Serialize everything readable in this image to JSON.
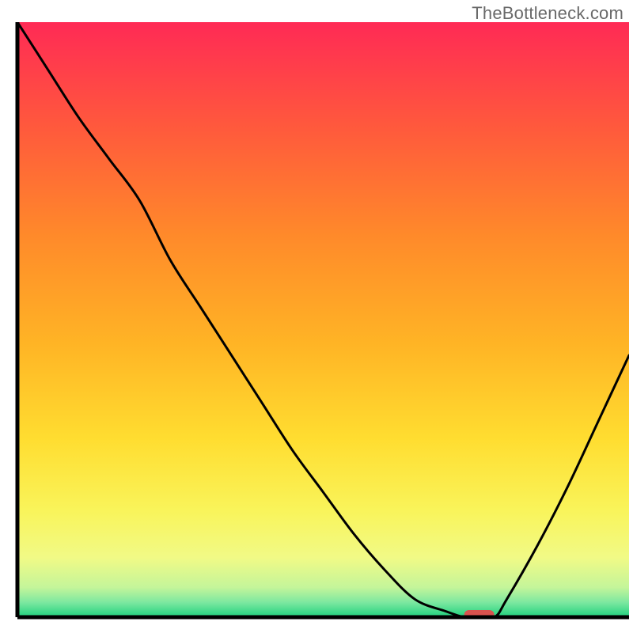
{
  "watermark": "TheBottleneck.com",
  "chart_data": {
    "type": "line",
    "title": "",
    "xlabel": "",
    "ylabel": "",
    "xlim": [
      0,
      100
    ],
    "ylim": [
      0,
      100
    ],
    "x": [
      0,
      5,
      10,
      15,
      20,
      25,
      30,
      35,
      40,
      45,
      50,
      55,
      60,
      65,
      70,
      73,
      75,
      78,
      80,
      85,
      90,
      95,
      100
    ],
    "y": [
      100,
      92,
      84,
      77,
      70,
      60,
      52,
      44,
      36,
      28,
      21,
      14,
      8,
      3,
      1,
      0,
      0,
      0,
      3,
      12,
      22,
      33,
      44
    ],
    "marker": {
      "x": 75.5,
      "y": 0
    },
    "gradient_stops": [
      {
        "offset": 0.0,
        "color": "#ff2a55"
      },
      {
        "offset": 0.18,
        "color": "#ff5a3c"
      },
      {
        "offset": 0.36,
        "color": "#ff8a2a"
      },
      {
        "offset": 0.54,
        "color": "#ffb425"
      },
      {
        "offset": 0.7,
        "color": "#ffdd30"
      },
      {
        "offset": 0.82,
        "color": "#f9f45a"
      },
      {
        "offset": 0.9,
        "color": "#f1fa86"
      },
      {
        "offset": 0.95,
        "color": "#c4f59a"
      },
      {
        "offset": 0.975,
        "color": "#7de8a0"
      },
      {
        "offset": 1.0,
        "color": "#1fd17e"
      }
    ]
  },
  "colors": {
    "axis": "#000000",
    "curve": "#000000",
    "marker": "#d9534f",
    "watermark": "#696969"
  }
}
